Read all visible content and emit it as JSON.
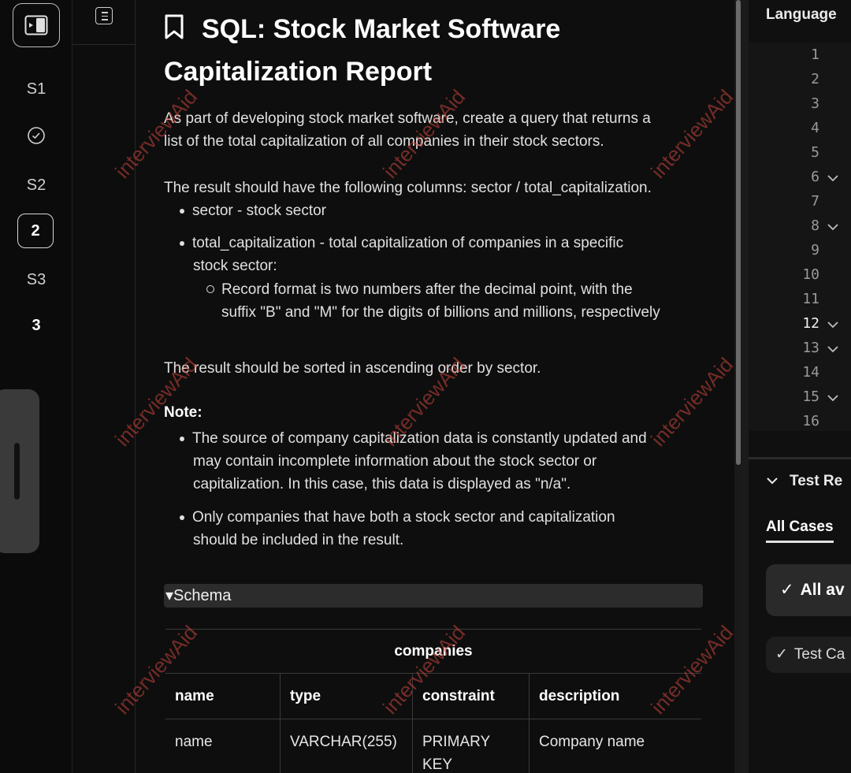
{
  "rail": {
    "items": [
      {
        "label": "S1"
      },
      {
        "label": "S2"
      },
      {
        "label": "2"
      },
      {
        "label": "S3"
      },
      {
        "label": "3"
      }
    ]
  },
  "problem": {
    "title": "SQL: Stock Market Software Capitalization Report",
    "intro_line1": "As part of developing stock market software, create a query that returns a",
    "intro_line2": "list of the total capitalization of all companies in their stock sectors.",
    "result_cols_line": "The result should have the following columns: sector / total_capitalization.",
    "bullets": {
      "sector": "sector - stock sector",
      "total_cap_1": "total_capitalization - total capitalization of companies in a specific",
      "total_cap_2": "stock sector:",
      "sub_1": "Record format is two numbers after the decimal point, with the",
      "sub_2": "suffix \"B\" and \"M\" for the digits of billions and millions, respectively"
    },
    "sorted_line": "The result should be sorted in ascending order by sector.",
    "note_heading": "Note:",
    "notes": {
      "n1_1": "The source of company capitalization data is constantly updated and",
      "n1_2": "may contain incomplete information about the stock sector or",
      "n1_3": "capitalization. In this case, this data is displayed as \"n/a\".",
      "n2_1": "Only companies that have both a stock sector and capitalization",
      "n2_2": "should be included in the result."
    },
    "schema_label": "▾Schema",
    "table": {
      "caption": "companies",
      "headers": [
        "name",
        "type",
        "constraint",
        "description"
      ],
      "rows": [
        [
          "name",
          "VARCHAR(255)",
          "PRIMARY KEY",
          "Company name"
        ]
      ]
    }
  },
  "right": {
    "language_label": "Language",
    "line_numbers": [
      "1",
      "2",
      "3",
      "4",
      "5",
      "6",
      "7",
      "8",
      "9",
      "10",
      "11",
      "12",
      "13",
      "14",
      "15",
      "16"
    ],
    "test_results_label": "Test Re",
    "all_cases_label": "All Cases",
    "case_a": "All av",
    "case_b": "Test Ca"
  },
  "watermark": "interviewAid",
  "colors": {
    "watermark": "#c8463c",
    "accent": "#ffffff"
  }
}
